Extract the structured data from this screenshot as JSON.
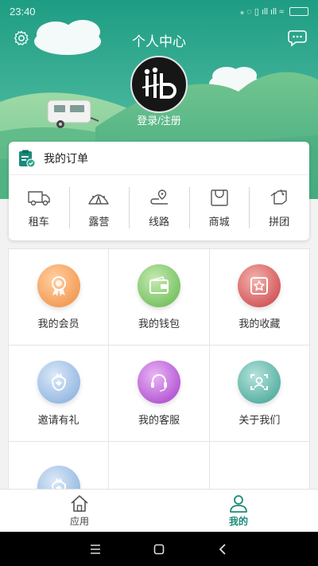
{
  "status_bar": {
    "time": "23:40",
    "icons_text": "⁎ ◌ ▯ ıll ıll ≈",
    "battery": ""
  },
  "header": {
    "title": "个人中心",
    "login_label": "登录/注册"
  },
  "orders": {
    "title": "我的订单",
    "categories": [
      {
        "label": "租车",
        "icon": "truck-icon"
      },
      {
        "label": "露营",
        "icon": "tent-icon"
      },
      {
        "label": "线路",
        "icon": "route-icon"
      },
      {
        "label": "商城",
        "icon": "shopping-bag-icon"
      },
      {
        "label": "拼团",
        "icon": "group-tag-icon"
      }
    ]
  },
  "grid": {
    "items": [
      {
        "label": "我的会员",
        "icon": "medal-icon",
        "color": "#f3a15b"
      },
      {
        "label": "我的钱包",
        "icon": "wallet-icon",
        "color": "#7cc466"
      },
      {
        "label": "我的收藏",
        "icon": "star-icon",
        "color": "#d9595d"
      },
      {
        "label": "邀请有礼",
        "icon": "gift-icon",
        "color": "#7fa9db"
      },
      {
        "label": "我的客服",
        "icon": "headset-icon",
        "color": "#b94fd6"
      },
      {
        "label": "关于我们",
        "icon": "about-icon",
        "color": "#4fb3a5"
      },
      {
        "label": "",
        "icon": "gift-icon",
        "color": "#7fa9db"
      }
    ]
  },
  "tabs": [
    {
      "label": "应用",
      "icon": "home-icon",
      "active": false
    },
    {
      "label": "我的",
      "icon": "user-icon",
      "active": true
    }
  ],
  "colors": {
    "accent": "#1a8a78",
    "header_top": "#3fb8a0",
    "hill": "#6fc59a"
  }
}
